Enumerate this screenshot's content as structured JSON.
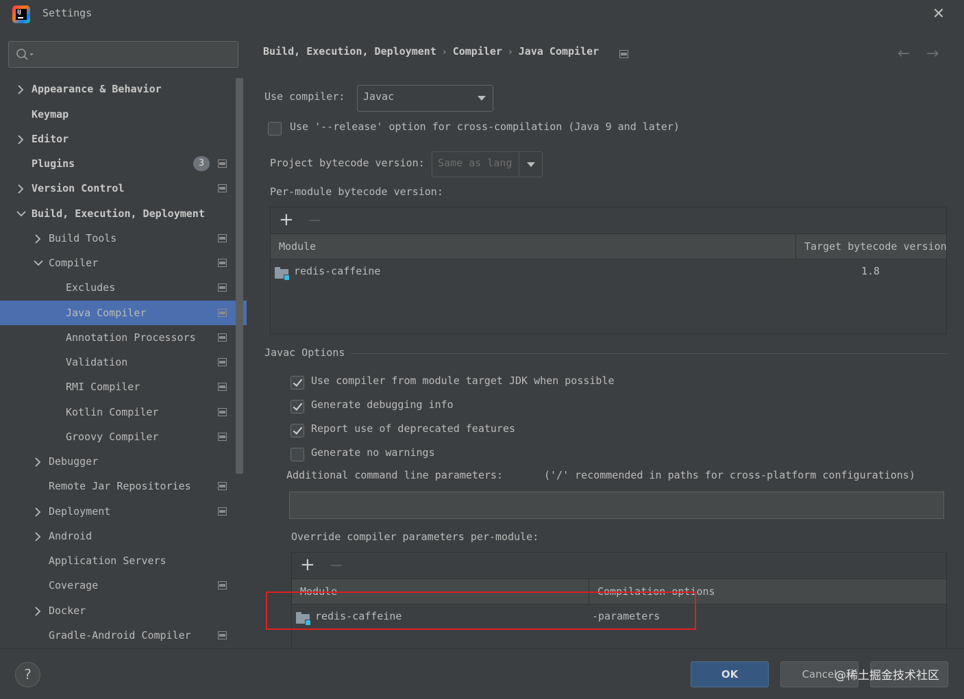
{
  "window": {
    "title": "Settings",
    "close_glyph": "✕"
  },
  "sidebar": {
    "search": {
      "value": "",
      "placeholder": ""
    },
    "items": [
      {
        "label": "Appearance & Behavior"
      },
      {
        "label": "Keymap"
      },
      {
        "label": "Editor"
      },
      {
        "label": "Plugins",
        "badge": "3"
      },
      {
        "label": "Version Control"
      },
      {
        "label": "Build, Execution, Deployment"
      },
      {
        "label": "Build Tools"
      },
      {
        "label": "Compiler"
      },
      {
        "label": "Excludes"
      },
      {
        "label": "Java Compiler",
        "selected": true
      },
      {
        "label": "Annotation Processors"
      },
      {
        "label": "Validation"
      },
      {
        "label": "RMI Compiler"
      },
      {
        "label": "Kotlin Compiler"
      },
      {
        "label": "Groovy Compiler"
      },
      {
        "label": "Debugger"
      },
      {
        "label": "Remote Jar Repositories"
      },
      {
        "label": "Deployment"
      },
      {
        "label": "Android"
      },
      {
        "label": "Application Servers"
      },
      {
        "label": "Coverage"
      },
      {
        "label": "Docker"
      },
      {
        "label": "Gradle-Android Compiler"
      }
    ]
  },
  "breadcrumb": {
    "parts": [
      "Build, Execution, Deployment",
      "Compiler",
      "Java Compiler"
    ],
    "sep": "›"
  },
  "nav": {
    "back": "←",
    "forward": "→"
  },
  "compiler": {
    "use_compiler_label": "Use compiler:",
    "use_compiler_value": "Javac",
    "release_option_label": "Use '--release' option for cross-compilation (Java 9 and later)",
    "release_option_checked": false,
    "bytecode_label": "Project bytecode version:",
    "bytecode_value": "Same as lang",
    "per_module_label": "Per-module bytecode version:",
    "per_module_table": {
      "columns": [
        "Module",
        "Target bytecode version"
      ],
      "rows": [
        {
          "module": "redis-caffeine",
          "version": "1.8"
        }
      ]
    }
  },
  "javac": {
    "section_title": "Javac Options",
    "options": [
      {
        "label": "Use compiler from module target JDK when possible",
        "checked": true
      },
      {
        "label": "Generate debugging info",
        "checked": true
      },
      {
        "label": "Report use of deprecated features",
        "checked": true
      },
      {
        "label": "Generate no warnings",
        "checked": false
      }
    ],
    "additional_params_label": "Additional command line parameters:",
    "additional_params_hint": "('/' recommended in paths for cross-platform configurations)",
    "additional_params_value": "",
    "override_label": "Override compiler parameters per-module:",
    "override_table": {
      "columns": [
        "Module",
        "Compilation options"
      ],
      "rows": [
        {
          "module": "redis-caffeine",
          "options": "-parameters"
        }
      ]
    }
  },
  "footer": {
    "help": "?",
    "ok": "OK",
    "cancel": "Cancel",
    "watermark": "@稀土掘金技术社区"
  },
  "colors": {
    "background": "#3c3f41",
    "selection": "#4b6eaf",
    "ok_button": "#365880",
    "highlight_box": "#e02020"
  }
}
